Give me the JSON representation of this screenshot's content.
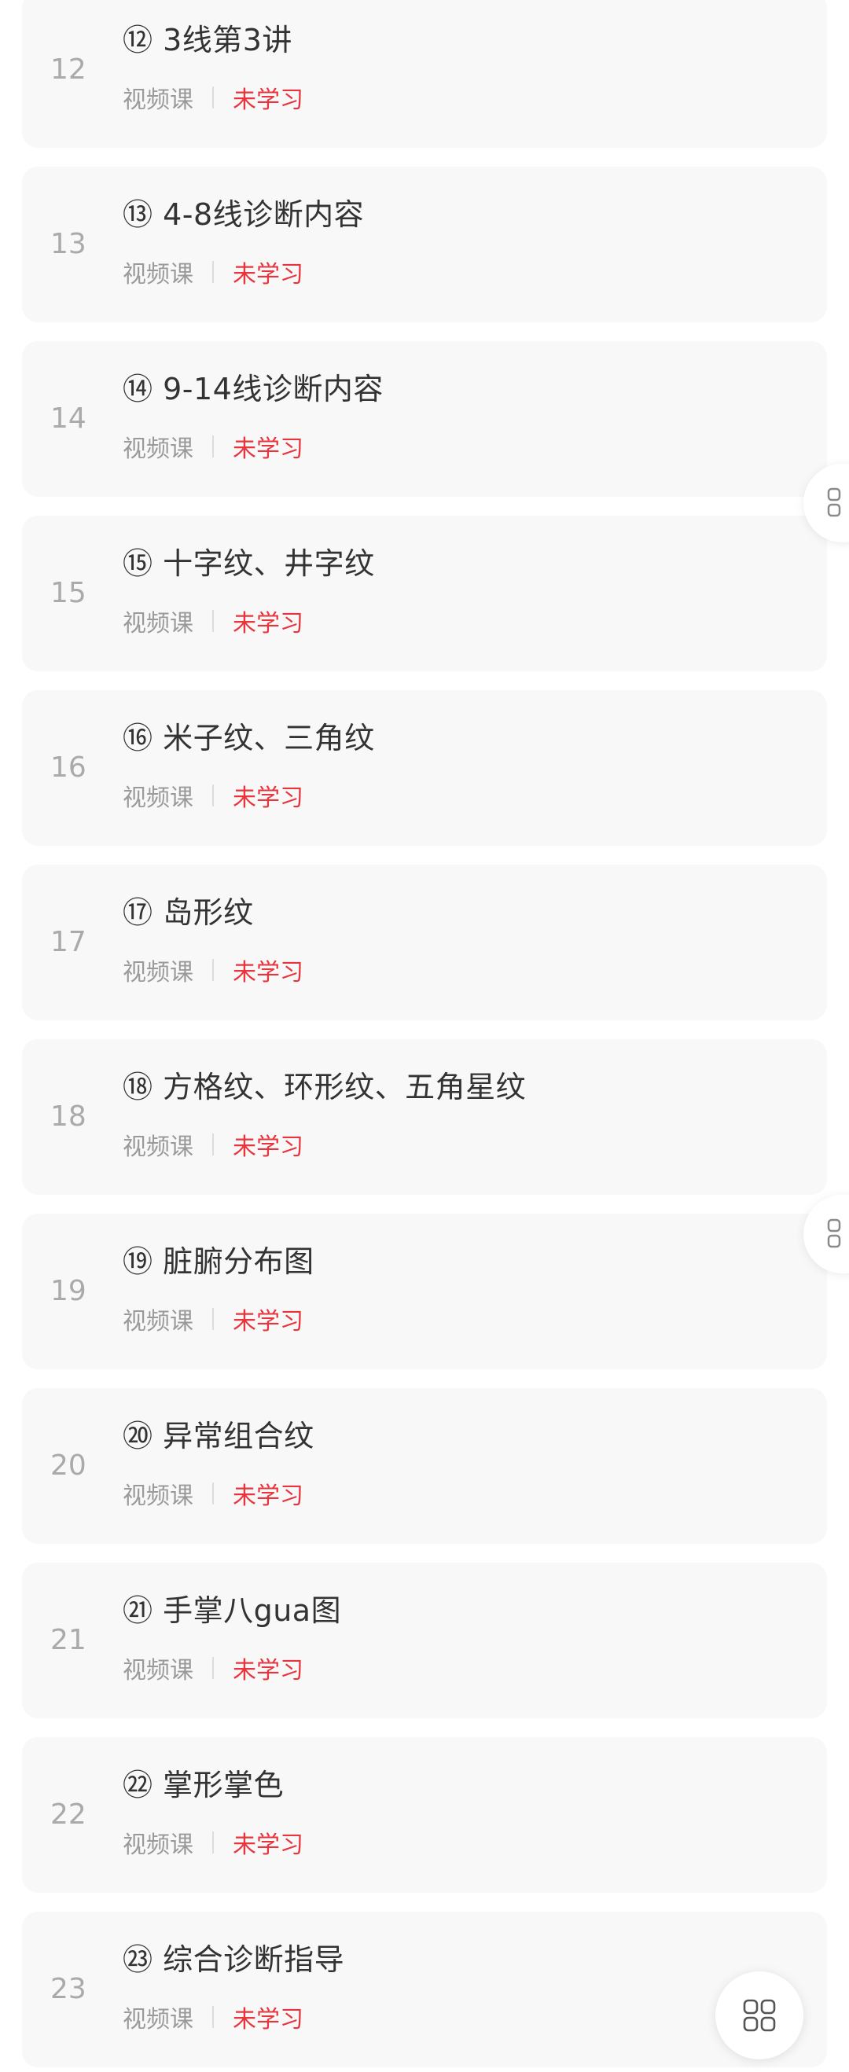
{
  "lessons": [
    {
      "index": "12",
      "title": "⑫ 3线第3讲",
      "type": "视频课",
      "status": "未学习"
    },
    {
      "index": "13",
      "title": "⑬ 4-8线诊断内容",
      "type": "视频课",
      "status": "未学习"
    },
    {
      "index": "14",
      "title": "⑭ 9-14线诊断内容",
      "type": "视频课",
      "status": "未学习"
    },
    {
      "index": "15",
      "title": "⑮ 十字纹、井字纹",
      "type": "视频课",
      "status": "未学习"
    },
    {
      "index": "16",
      "title": "⑯ 米子纹、三角纹",
      "type": "视频课",
      "status": "未学习"
    },
    {
      "index": "17",
      "title": "⑰ 岛形纹",
      "type": "视频课",
      "status": "未学习"
    },
    {
      "index": "18",
      "title": "⑱ 方格纹、环形纹、五角星纹",
      "type": "视频课",
      "status": "未学习"
    },
    {
      "index": "19",
      "title": "⑲ 脏腑分布图",
      "type": "视频课",
      "status": "未学习"
    },
    {
      "index": "20",
      "title": "⑳ 异常组合纹",
      "type": "视频课",
      "status": "未学习"
    },
    {
      "index": "21",
      "title": "㉑ 手掌八gua图",
      "type": "视频课",
      "status": "未学习"
    },
    {
      "index": "22",
      "title": "㉒ 掌形掌色",
      "type": "视频课",
      "status": "未学习"
    },
    {
      "index": "23",
      "title": "㉓ 综合诊断指导",
      "type": "视频课",
      "status": "未学习"
    }
  ],
  "icons": {
    "floating_button": "grid-icon",
    "side_tab": "grid-icon"
  },
  "colors": {
    "card_background": "#f8f8f8",
    "status_unlearned": "#e8353d",
    "title_text": "#333333",
    "muted_text": "#9a9a9a"
  }
}
